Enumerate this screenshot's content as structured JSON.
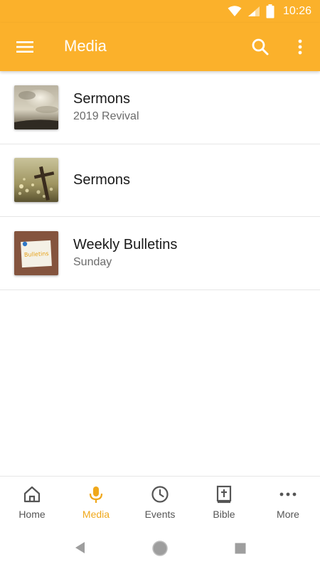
{
  "status_bar": {
    "time": "10:26",
    "icons": [
      "wifi-icon",
      "cell-signal-icon",
      "battery-icon"
    ]
  },
  "app_bar": {
    "title": "Media",
    "left_icon": "menu-icon",
    "right_icons": [
      "search-icon",
      "more-vertical-icon"
    ],
    "background": "#FBB12B"
  },
  "media_list": [
    {
      "title": "Sermons",
      "subtitle": "2019 Revival",
      "thumbnail": "clouds-sky-thumbnail"
    },
    {
      "title": "Sermons",
      "subtitle": "",
      "thumbnail": "cross-sunset-thumbnail"
    },
    {
      "title": "Weekly Bulletins",
      "subtitle": "Sunday",
      "thumbnail": "bulletins-note-thumbnail",
      "thumbnail_text": "Bulletins"
    }
  ],
  "bottom_nav": {
    "active_color": "#F0A81B",
    "items": [
      {
        "label": "Home",
        "icon": "home-icon",
        "active": false
      },
      {
        "label": "Media",
        "icon": "microphone-icon",
        "active": true
      },
      {
        "label": "Events",
        "icon": "clock-icon",
        "active": false
      },
      {
        "label": "Bible",
        "icon": "bible-icon",
        "active": false
      },
      {
        "label": "More",
        "icon": "more-horizontal-icon",
        "active": false
      }
    ]
  },
  "system_nav": {
    "icons": [
      "back-icon",
      "home-circle-icon",
      "recents-icon"
    ]
  }
}
